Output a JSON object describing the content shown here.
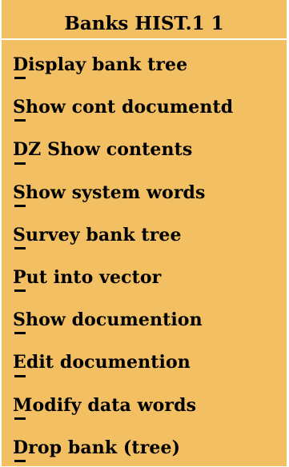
{
  "menu": {
    "title": "Banks HIST.1 1",
    "background_color": "#f2bf63",
    "items": [
      {
        "label": "Display bank tree"
      },
      {
        "label": "Show cont documentd"
      },
      {
        "label": "DZ Show contents"
      },
      {
        "label": "Show system words"
      },
      {
        "label": "Survey bank tree"
      },
      {
        "label": "Put into vector"
      },
      {
        "label": "Show documention"
      },
      {
        "label": "Edit documention"
      },
      {
        "label": "Modify data words"
      },
      {
        "label": "Drop bank (tree)"
      }
    ]
  }
}
